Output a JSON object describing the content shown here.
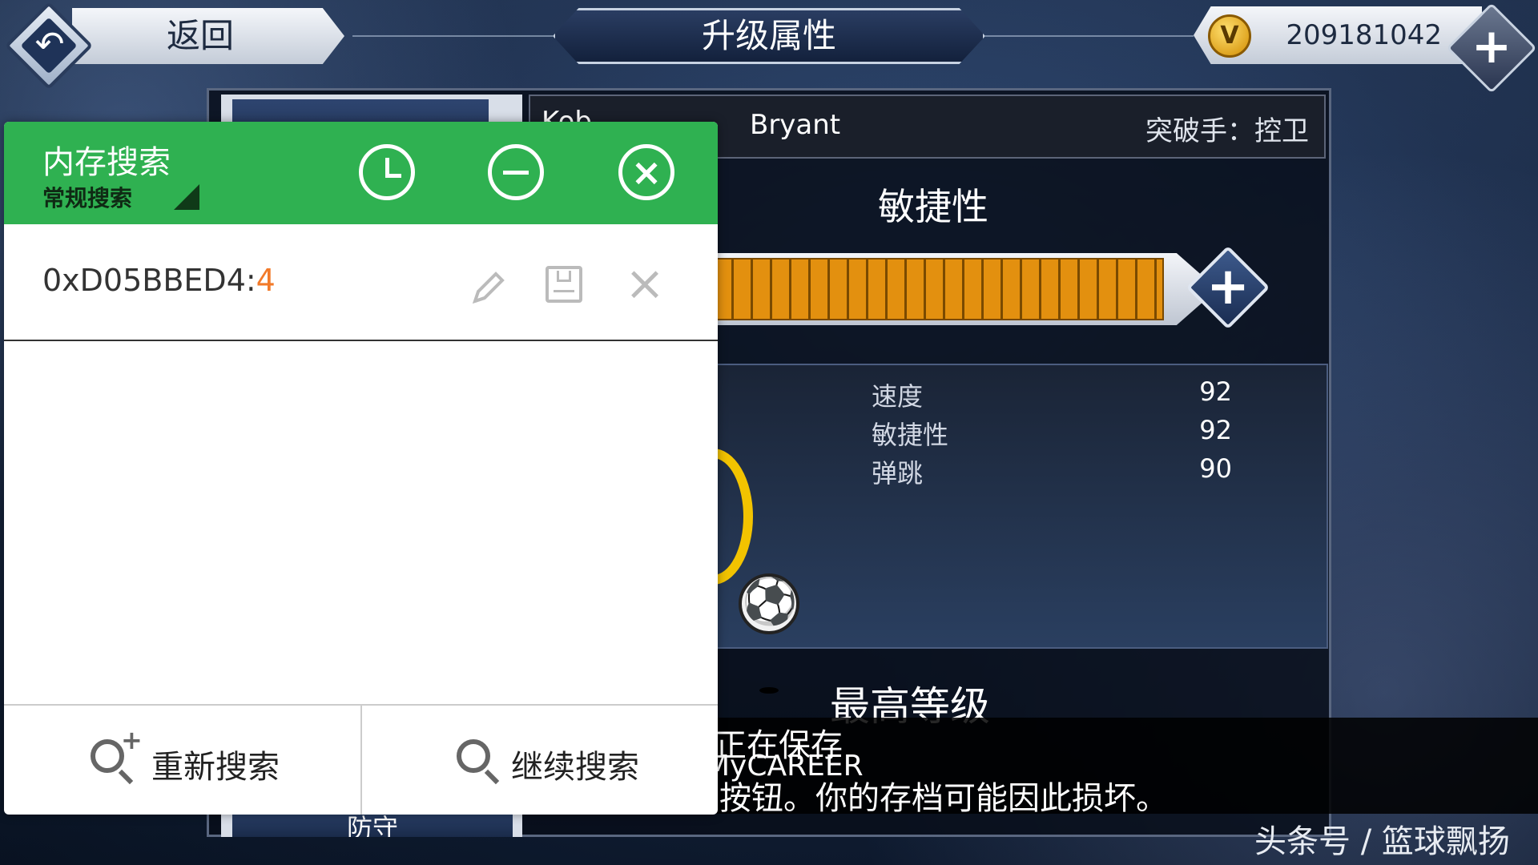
{
  "topbar": {
    "back_label": "返回",
    "title": "升级属性",
    "coins": "209181042"
  },
  "player": {
    "first_name": "Kob",
    "last_name": "Bryant",
    "role": "突破手：控卫"
  },
  "attribute": {
    "name": "敏捷性",
    "bar_fill_fraction": 0.97,
    "stats": [
      {
        "label": "速度",
        "value": "92"
      },
      {
        "label": "敏捷性",
        "value": "92"
      },
      {
        "label": "弹跳",
        "value": "90"
      }
    ],
    "max_level_label": "最高等级"
  },
  "tabs": {
    "bottom_label": "防守"
  },
  "save_banner": {
    "line1": "正在保存",
    "line2": "MyCAREER",
    "line3": "按钮。你的存档可能因此损坏。"
  },
  "memory_search": {
    "title": "内存搜索",
    "subtitle": "常规搜索",
    "results": [
      {
        "address": "0xD05BBED4:",
        "value": "4"
      }
    ],
    "research_label": "重新搜索",
    "continue_label": "继续搜索",
    "accent": "#2fb151"
  },
  "watermark": "头条号 / 篮球飘扬"
}
